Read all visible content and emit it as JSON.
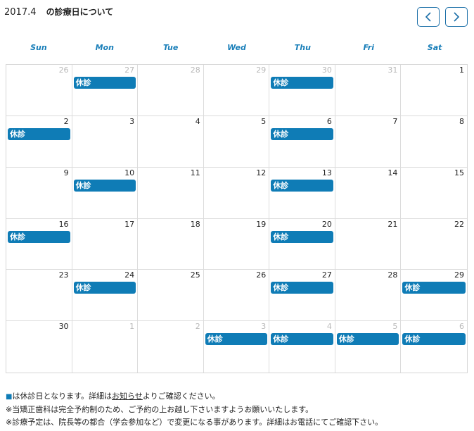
{
  "header": {
    "month": "2017.4",
    "title_suffix": "の診療日について",
    "prev_icon": "chevron-left-icon",
    "next_icon": "chevron-right-icon"
  },
  "colors": {
    "accent": "#0f7cb6",
    "dow_text": "#1a7fb9",
    "border": "#1b6fa8"
  },
  "weekdays": [
    "Sun",
    "Mon",
    "Tue",
    "Wed",
    "Thu",
    "Fri",
    "Sat"
  ],
  "weeks": [
    [
      {
        "day": "26",
        "other": true,
        "event": ""
      },
      {
        "day": "27",
        "other": true,
        "event": "休診"
      },
      {
        "day": "28",
        "other": true,
        "event": ""
      },
      {
        "day": "29",
        "other": true,
        "event": ""
      },
      {
        "day": "30",
        "other": true,
        "event": "休診"
      },
      {
        "day": "31",
        "other": true,
        "event": ""
      },
      {
        "day": "1",
        "other": false,
        "event": ""
      }
    ],
    [
      {
        "day": "2",
        "other": false,
        "event": "休診"
      },
      {
        "day": "3",
        "other": false,
        "event": ""
      },
      {
        "day": "4",
        "other": false,
        "event": ""
      },
      {
        "day": "5",
        "other": false,
        "event": ""
      },
      {
        "day": "6",
        "other": false,
        "event": "休診"
      },
      {
        "day": "7",
        "other": false,
        "event": ""
      },
      {
        "day": "8",
        "other": false,
        "event": ""
      }
    ],
    [
      {
        "day": "9",
        "other": false,
        "event": ""
      },
      {
        "day": "10",
        "other": false,
        "event": "休診"
      },
      {
        "day": "11",
        "other": false,
        "event": ""
      },
      {
        "day": "12",
        "other": false,
        "event": ""
      },
      {
        "day": "13",
        "other": false,
        "event": "休診"
      },
      {
        "day": "14",
        "other": false,
        "event": ""
      },
      {
        "day": "15",
        "other": false,
        "event": ""
      }
    ],
    [
      {
        "day": "16",
        "other": false,
        "event": "休診"
      },
      {
        "day": "17",
        "other": false,
        "event": ""
      },
      {
        "day": "18",
        "other": false,
        "event": ""
      },
      {
        "day": "19",
        "other": false,
        "event": ""
      },
      {
        "day": "20",
        "other": false,
        "event": "休診"
      },
      {
        "day": "21",
        "other": false,
        "event": ""
      },
      {
        "day": "22",
        "other": false,
        "event": ""
      }
    ],
    [
      {
        "day": "23",
        "other": false,
        "event": ""
      },
      {
        "day": "24",
        "other": false,
        "event": "休診"
      },
      {
        "day": "25",
        "other": false,
        "event": ""
      },
      {
        "day": "26",
        "other": false,
        "event": ""
      },
      {
        "day": "27",
        "other": false,
        "event": "休診"
      },
      {
        "day": "28",
        "other": false,
        "event": ""
      },
      {
        "day": "29",
        "other": false,
        "event": "休診"
      }
    ],
    [
      {
        "day": "30",
        "other": false,
        "event": ""
      },
      {
        "day": "1",
        "other": true,
        "event": ""
      },
      {
        "day": "2",
        "other": true,
        "event": ""
      },
      {
        "day": "3",
        "other": true,
        "event": "休診"
      },
      {
        "day": "4",
        "other": true,
        "event": "休診"
      },
      {
        "day": "5",
        "other": true,
        "event": "休診"
      },
      {
        "day": "6",
        "other": true,
        "event": "休診"
      }
    ]
  ],
  "notes": {
    "line1_marker": "■",
    "line1_pre": "は休診日となります。詳細は",
    "line1_link": "お知らせ",
    "line1_post": "よりご確認ください。",
    "line2": "※当矯正歯科は完全予約制のため、ご予約の上お越し下さいますようお願いいたします。",
    "line3": "※診療予定は、院長等の都合（学会参加など）で変更になる事があります。詳細はお電話にてご確認下さい。"
  }
}
